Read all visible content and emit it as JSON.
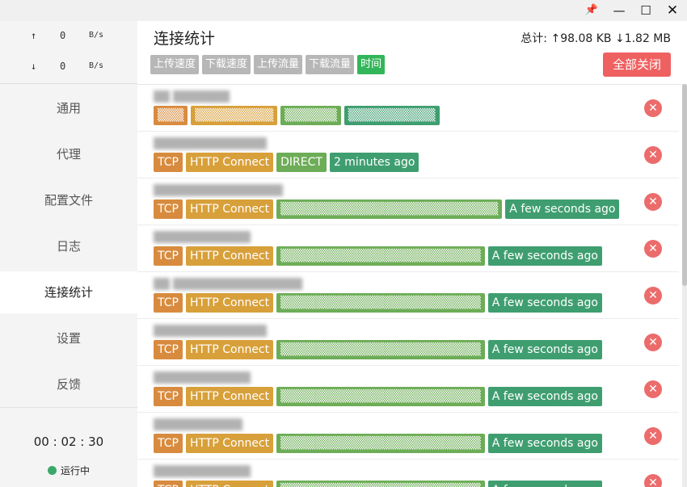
{
  "window": {
    "pin_icon": "📌",
    "min_icon": "—",
    "max_icon": "☐",
    "close_icon": "✕"
  },
  "sidebar": {
    "upload": {
      "arrow": "↑",
      "value": "0",
      "unit": "B/s"
    },
    "download": {
      "arrow": "↓",
      "value": "0",
      "unit": "B/s"
    },
    "items": [
      {
        "label": "通用"
      },
      {
        "label": "代理"
      },
      {
        "label": "配置文件"
      },
      {
        "label": "日志"
      },
      {
        "label": "连接统计"
      },
      {
        "label": "设置"
      },
      {
        "label": "反馈"
      }
    ],
    "active_item": "连接统计",
    "uptime": "00 : 02 : 30",
    "status": "运行中",
    "status_color": "#3aa86b"
  },
  "main": {
    "title": "连接统计",
    "totals": "总计:  ↑98.08 KB ↓1.82 MB",
    "sort_tags": [
      "上传速度",
      "下载速度",
      "上传流量",
      "下载流量",
      "时间"
    ],
    "active_sort": "时间",
    "close_all": "全部关闭",
    "colors": {
      "network": "#d88b3e",
      "type": "#d8a03a",
      "chain": "#6dad57",
      "time": "#3f9e70",
      "close": "#ef6161",
      "active_sort": "#33b65a"
    }
  },
  "connections": [
    {
      "host": "▒▒ ▒▒▒▒▒▒▒",
      "network": "▒▒▒",
      "type": "▒▒▒▒▒▒▒▒▒",
      "chain": "▒▒▒▒▒▒",
      "time": "▒▒▒▒▒▒▒▒▒▒",
      "close_icon": "✕"
    },
    {
      "host": "▒▒▒▒▒▒▒▒▒▒▒▒▒▒",
      "network": "TCP",
      "type": "HTTP Connect",
      "chain": "DIRECT",
      "time": "2 minutes ago",
      "close_icon": "✕"
    },
    {
      "host": "▒▒▒▒▒▒▒▒▒▒▒▒▒▒▒▒",
      "network": "TCP",
      "type": "HTTP Connect",
      "chain": "▒▒▒▒▒▒▒▒▒▒▒▒▒▒▒▒▒▒▒▒▒▒▒▒▒",
      "time": "A few seconds ago",
      "close_icon": "✕"
    },
    {
      "host": "▒▒▒▒▒▒▒▒▒▒▒▒",
      "network": "TCP",
      "type": "HTTP Connect",
      "chain": "▒▒▒▒▒▒▒▒▒▒▒▒▒▒▒▒▒▒▒▒▒▒▒",
      "time": "A few seconds ago",
      "close_icon": "✕"
    },
    {
      "host": "▒▒ ▒▒▒▒▒▒▒▒▒▒▒▒▒▒▒▒",
      "network": "TCP",
      "type": "HTTP Connect",
      "chain": "▒▒▒▒▒▒▒▒▒▒▒▒▒▒▒▒▒▒▒▒▒▒▒",
      "time": "A few seconds ago",
      "close_icon": "✕"
    },
    {
      "host": "▒▒▒▒▒▒▒▒▒▒▒▒▒▒",
      "network": "TCP",
      "type": "HTTP Connect",
      "chain": "▒▒▒▒▒▒▒▒▒▒▒▒▒▒▒▒▒▒▒▒▒▒▒",
      "time": "A few seconds ago",
      "close_icon": "✕"
    },
    {
      "host": "▒▒▒▒▒▒▒▒▒▒▒▒",
      "network": "TCP",
      "type": "HTTP Connect",
      "chain": "▒▒▒▒▒▒▒▒▒▒▒▒▒▒▒▒▒▒▒▒▒▒▒",
      "time": "A few seconds ago",
      "close_icon": "✕"
    },
    {
      "host": "▒▒▒▒▒▒▒▒▒▒▒",
      "network": "TCP",
      "type": "HTTP Connect",
      "chain": "▒▒▒▒▒▒▒▒▒▒▒▒▒▒▒▒▒▒▒▒▒▒▒",
      "time": "A few seconds ago",
      "close_icon": "✕"
    },
    {
      "host": "▒▒▒▒▒▒▒▒▒▒▒▒",
      "network": "TCP",
      "type": "HTTP Connect",
      "chain": "▒▒▒▒▒▒▒▒▒▒▒▒▒▒▒▒▒▒▒▒▒▒▒",
      "time": "A few seconds ago",
      "close_icon": "✕"
    }
  ]
}
